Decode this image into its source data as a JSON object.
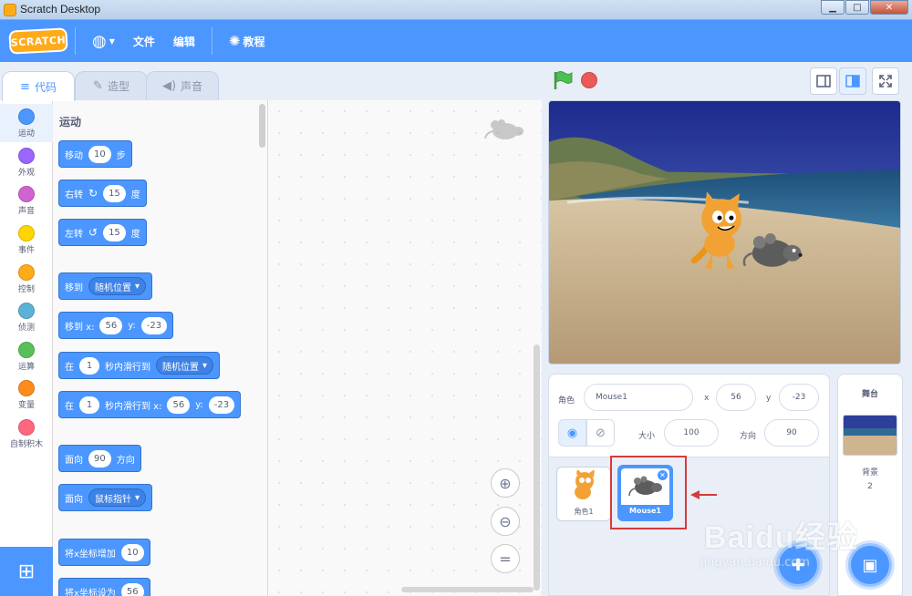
{
  "window": {
    "title": "Scratch Desktop"
  },
  "menubar": {
    "logo": "SCRATCH",
    "items": [
      "文件",
      "编辑"
    ],
    "tutorials": "教程"
  },
  "tabs": [
    "代码",
    "造型",
    "声音"
  ],
  "categories": [
    {
      "label": "运动",
      "color": "#4c97ff"
    },
    {
      "label": "外观",
      "color": "#9966ff"
    },
    {
      "label": "声音",
      "color": "#cf63cf"
    },
    {
      "label": "事件",
      "color": "#ffd500"
    },
    {
      "label": "控制",
      "color": "#ffab19"
    },
    {
      "label": "侦测",
      "color": "#5cb1d6"
    },
    {
      "label": "运算",
      "color": "#59c059"
    },
    {
      "label": "变量",
      "color": "#ff8c1a"
    },
    {
      "label": "自制积木",
      "color": "#ff6680"
    }
  ],
  "palette": {
    "section_title": "运动",
    "blocks": {
      "move": {
        "label": "移动",
        "value": "10",
        "suffix": "步"
      },
      "turn_right": {
        "label": "右转",
        "value": "15",
        "suffix": "度"
      },
      "turn_left": {
        "label": "左转",
        "value": "15",
        "suffix": "度"
      },
      "goto": {
        "label": "移到",
        "option": "随机位置"
      },
      "goto_xy": {
        "label": "移到 x:",
        "x": "56",
        "ylabel": "y:",
        "y": "-23"
      },
      "glide": {
        "label": "在",
        "secs": "1",
        "mid": "秒内滑行到",
        "option": "随机位置"
      },
      "glide_xy": {
        "label": "在",
        "secs": "1",
        "mid": "秒内滑行到 x:",
        "x": "56",
        "ylabel": "y:",
        "y": "-23"
      },
      "point_dir": {
        "label": "面向",
        "value": "90",
        "suffix": "方向"
      },
      "point_toward": {
        "label": "面向",
        "option": "鼠标指针"
      },
      "change_x": {
        "label": "将x坐标增加",
        "value": "10"
      },
      "set_x": {
        "label": "将x坐标设为",
        "value": "56"
      }
    }
  },
  "sprite_info": {
    "sprite_label": "角色",
    "sprite_name": "Mouse1",
    "x_label": "x",
    "x": "56",
    "y_label": "y",
    "y": "-23",
    "size_label": "大小",
    "size": "100",
    "direction_label": "方向",
    "direction": "90"
  },
  "sprites": [
    {
      "label": "角色1"
    },
    {
      "label": "Mouse1",
      "selected": true
    }
  ],
  "stage_pane": {
    "title": "舞台",
    "backdrops_label": "背景",
    "backdrops_count": "2"
  },
  "watermark": {
    "text": "Baidu经验",
    "url": "jingyan.baidu.com"
  },
  "colors": {
    "accent": "#4c97ff",
    "menubar": "#4c97ff",
    "highlight": "#d63b3b"
  }
}
